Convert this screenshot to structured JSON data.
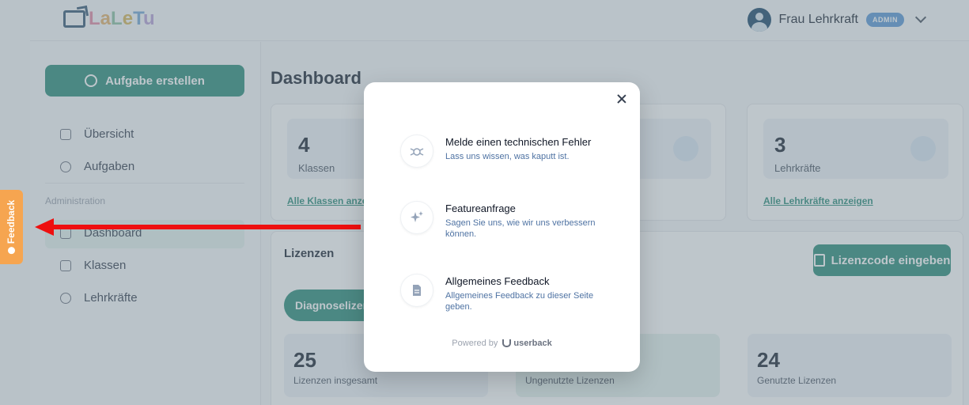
{
  "app": {
    "logo_text": [
      "L",
      "a",
      "L",
      "e",
      "T",
      "u"
    ],
    "user_name": "Frau Lehrkraft",
    "user_role_badge": "ADMIN"
  },
  "sidebar": {
    "create_button": "Aufgabe erstellen",
    "items": [
      {
        "label": "Übersicht"
      },
      {
        "label": "Aufgaben"
      }
    ],
    "section_title": "Administration",
    "admin_items": [
      {
        "label": "Dashboard"
      },
      {
        "label": "Klassen"
      },
      {
        "label": "Lehrkräfte"
      }
    ]
  },
  "main": {
    "title": "Dashboard",
    "stats": [
      {
        "value": "4",
        "label": "Klassen",
        "link": "Alle Klassen anzeigen"
      },
      {
        "value": "3",
        "label": "Lehrkräfte",
        "link": "Alle Lehrkräfte anzeigen"
      }
    ],
    "licenses": {
      "title": "Lizenzen",
      "enter_code_button": "Lizenzcode eingeben",
      "tab": "Diagnoselizenzen",
      "stats": [
        {
          "value": "25",
          "label": "Lizenzen insgesamt"
        },
        {
          "value": "",
          "label": "Ungenutzte Lizenzen"
        },
        {
          "value": "24",
          "label": "Genutzte Lizenzen"
        }
      ]
    }
  },
  "feedback_tab": {
    "label": "Feedback",
    "color": "#f6a550"
  },
  "arrow_color": "#ee0f0f",
  "modal": {
    "options": [
      {
        "title": "Melde einen technischen Fehler",
        "desc": "Lass uns wissen, was kaputt ist.",
        "icon": "bug-icon"
      },
      {
        "title": "Featureanfrage",
        "desc": "Sagen Sie uns, wie wir uns verbessern können.",
        "icon": "sparkle-icon"
      },
      {
        "title": "Allgemeines Feedback",
        "desc": "Allgemeines Feedback zu dieser Seite geben.",
        "icon": "document-icon"
      }
    ],
    "powered_by": "Powered by",
    "brand": "userback"
  }
}
